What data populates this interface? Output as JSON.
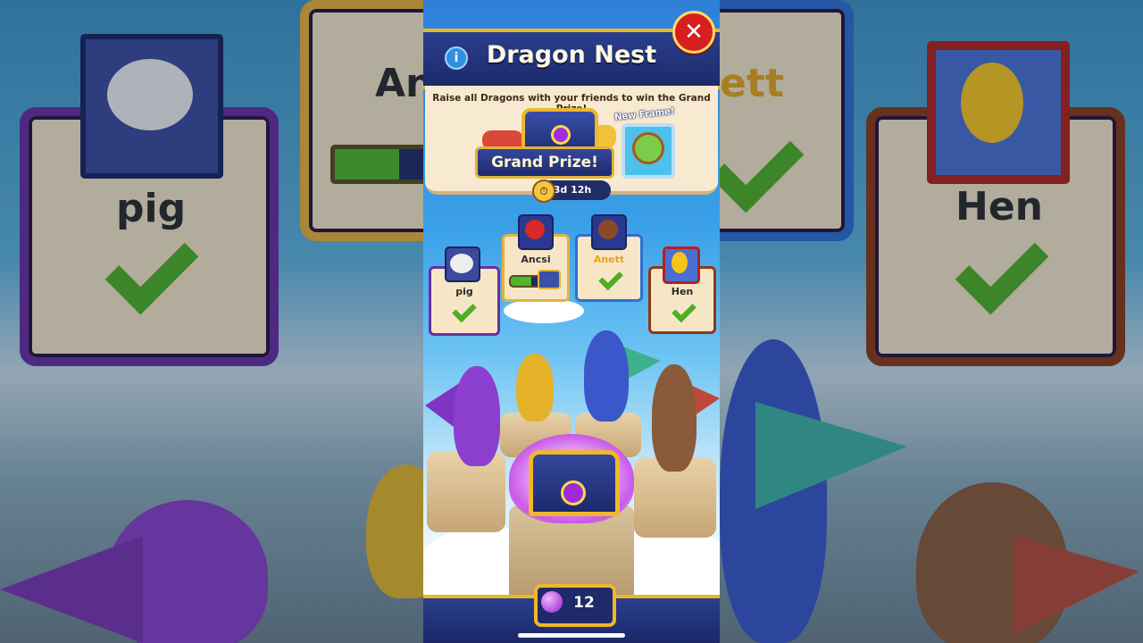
{
  "header": {
    "title": "Dragon Nest",
    "close_label": "✕",
    "info_label": "i"
  },
  "prize": {
    "description": "Raise all Dragons with your friends to win the Grand Prize!",
    "banner": "Grand Prize!",
    "new_frame_label": "New Frame!"
  },
  "timer": {
    "label": "3d 12h"
  },
  "friends": [
    {
      "name": "pig",
      "status": "complete",
      "frame_color": "#6a2fa0"
    },
    {
      "name": "Ancsi",
      "status": "in-progress",
      "progress": 0.45,
      "frame_color": "#e6b13a"
    },
    {
      "name": "Anett",
      "status": "complete",
      "frame_color": "#2f6fd0"
    },
    {
      "name": "Hen",
      "status": "complete",
      "frame_color": "#8a3a16"
    }
  ],
  "background": {
    "left_name": "pig",
    "left_partial_name": "An",
    "right_partial_name": "ett",
    "right_name": "Hen"
  },
  "gems": {
    "count": "12"
  },
  "colors": {
    "accent_gold": "#e8b923",
    "navy": "#1f2c66",
    "check_green": "#4fae24"
  }
}
